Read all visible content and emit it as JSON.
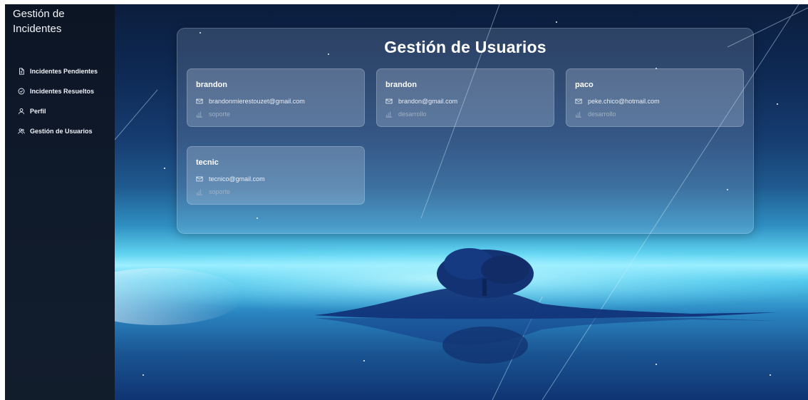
{
  "sidebar": {
    "brand": "Gestión de Incidentes",
    "items": [
      {
        "label": "Incidentes Pendientes",
        "icon": "file-icon"
      },
      {
        "label": "Incidentes Resueltos",
        "icon": "check-circle-icon"
      },
      {
        "label": "Perfil",
        "icon": "user-icon"
      },
      {
        "label": "Gestión de Usuarios",
        "icon": "users-icon"
      }
    ]
  },
  "main": {
    "title": "Gestión de Usuarios",
    "users": [
      {
        "name": "brandon",
        "email": "brandonmierestouzet@gmail.com",
        "role": "soporte"
      },
      {
        "name": "brandon",
        "email": "brandon@gmail.com",
        "role": "desarrollo"
      },
      {
        "name": "paco",
        "email": "peke.chico@hotmail.com",
        "role": "desarrollo"
      },
      {
        "name": "tecnic",
        "email": "tecnico@gmail.com",
        "role": "soporte"
      }
    ]
  },
  "colors": {
    "sidebar_bg": "#0f1a2b",
    "text": "#ffffff",
    "role_text": "#9fb0c6"
  }
}
